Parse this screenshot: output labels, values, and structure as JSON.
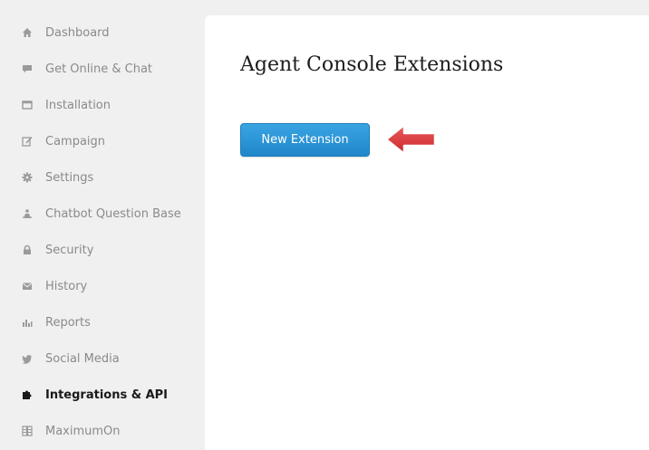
{
  "sidebar": {
    "items": [
      {
        "label": "Dashboard",
        "icon": "home-icon"
      },
      {
        "label": "Get Online & Chat",
        "icon": "chat-icon"
      },
      {
        "label": "Installation",
        "icon": "window-icon"
      },
      {
        "label": "Campaign",
        "icon": "edit-icon"
      },
      {
        "label": "Settings",
        "icon": "gear-icon"
      },
      {
        "label": "Chatbot Question Base",
        "icon": "bot-icon"
      },
      {
        "label": "Security",
        "icon": "lock-icon"
      },
      {
        "label": "History",
        "icon": "mail-icon"
      },
      {
        "label": "Reports",
        "icon": "bar-chart-icon"
      },
      {
        "label": "Social Media",
        "icon": "twitter-bird-icon"
      },
      {
        "label": "Integrations & API",
        "icon": "puzzle-icon",
        "active": true
      },
      {
        "label": "MaximumOn",
        "icon": "grid-icon"
      }
    ]
  },
  "main": {
    "title": "Agent Console Extensions",
    "new_extension_label": "New Extension"
  },
  "colors": {
    "button": "#2a94d6",
    "arrow": "#d9373c",
    "sidebar_bg": "#f0f0f0",
    "active_text": "#1a1a1a",
    "inactive_text": "#8a8a8a"
  }
}
